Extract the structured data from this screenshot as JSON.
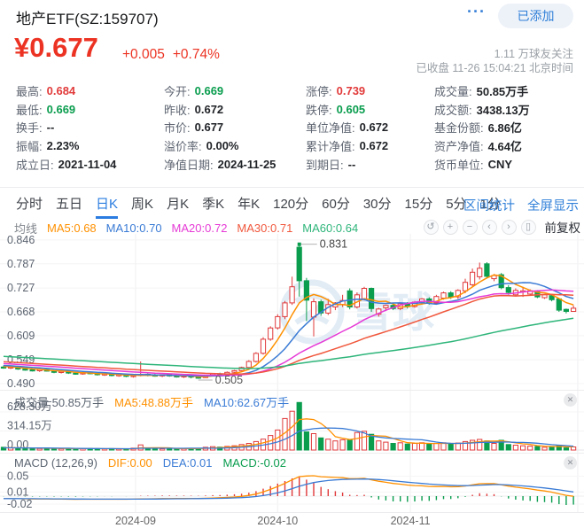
{
  "header": {
    "title": "地产ETF(SZ:159707)",
    "more_icon": "···",
    "added_button": "已添加",
    "price": "¥0.677",
    "change": "+0.005",
    "change_pct": "+0.74%",
    "followers": "1.11 万球友关注",
    "status_line": "已收盘 11-26 15:04:21 北京时间"
  },
  "stats": {
    "columns": [
      [
        {
          "label": "最高",
          "value": "0.684",
          "color": "red"
        },
        {
          "label": "最低",
          "value": "0.669",
          "color": "green"
        },
        {
          "label": "换手",
          "value": "--",
          "color": ""
        },
        {
          "label": "振幅",
          "value": "2.23%",
          "color": ""
        },
        {
          "label": "成立日",
          "value": "2021-11-04",
          "color": ""
        }
      ],
      [
        {
          "label": "今开",
          "value": "0.669",
          "color": "green"
        },
        {
          "label": "昨收",
          "value": "0.672",
          "color": ""
        },
        {
          "label": "市价",
          "value": "0.677",
          "color": ""
        },
        {
          "label": "溢价率",
          "value": "0.00%",
          "color": ""
        },
        {
          "label": "净值日期",
          "value": "2024-11-25",
          "color": ""
        }
      ],
      [
        {
          "label": "涨停",
          "value": "0.739",
          "color": "red"
        },
        {
          "label": "跌停",
          "value": "0.605",
          "color": "green"
        },
        {
          "label": "单位净值",
          "value": "0.672",
          "color": ""
        },
        {
          "label": "累计净值",
          "value": "0.672",
          "color": ""
        },
        {
          "label": "到期日",
          "value": "--",
          "color": ""
        }
      ],
      [
        {
          "label": "成交量",
          "value": "50.85万手",
          "color": ""
        },
        {
          "label": "成交额",
          "value": "3438.13万",
          "color": ""
        },
        {
          "label": "基金份额",
          "value": "6.86亿",
          "color": ""
        },
        {
          "label": "资产净值",
          "value": "4.64亿",
          "color": ""
        },
        {
          "label": "货币单位",
          "value": "CNY",
          "color": ""
        }
      ]
    ]
  },
  "tabs": {
    "items": [
      {
        "label": "分时",
        "active": false
      },
      {
        "label": "五日",
        "active": false
      },
      {
        "label": "日K",
        "active": true
      },
      {
        "label": "周K",
        "active": false
      },
      {
        "label": "月K",
        "active": false
      },
      {
        "label": "季K",
        "active": false
      },
      {
        "label": "年K",
        "active": false
      },
      {
        "label": "120分",
        "active": false
      },
      {
        "label": "60分",
        "active": false
      },
      {
        "label": "30分",
        "active": false
      },
      {
        "label": "15分",
        "active": false
      },
      {
        "label": "5分",
        "active": false
      },
      {
        "label": "1分",
        "active": false
      }
    ],
    "right_links": [
      "区间统计",
      "全屏显示"
    ]
  },
  "ma_legend": {
    "title": "均线",
    "items": [
      {
        "text": "MA5:0.68",
        "color": "#ff9000"
      },
      {
        "text": "MA10:0.70",
        "color": "#3a7bd5"
      },
      {
        "text": "MA20:0.72",
        "color": "#e63ad6"
      },
      {
        "text": "MA30:0.71",
        "color": "#f0573c"
      },
      {
        "text": "MA60:0.64",
        "color": "#2eb57a"
      }
    ]
  },
  "toolbar": {
    "icons": [
      {
        "name": "undo-icon",
        "glyph": "↺"
      },
      {
        "name": "zoom-in-icon",
        "glyph": "+"
      },
      {
        "name": "zoom-out-icon",
        "glyph": "−"
      },
      {
        "name": "pan-left-icon",
        "glyph": "‹"
      },
      {
        "name": "pan-right-icon",
        "glyph": "›"
      },
      {
        "name": "mobile-icon",
        "glyph": "▯"
      }
    ],
    "adjust_label": "前复权"
  },
  "volume_legend": {
    "items": [
      {
        "text": "成交量 50.85万手",
        "color": "#5b6470"
      },
      {
        "text": "MA5:48.88万手",
        "color": "#ff9000"
      },
      {
        "text": "MA10:62.67万手",
        "color": "#3a7bd5"
      }
    ]
  },
  "macd_legend": {
    "items": [
      {
        "text": "MACD (12,26,9)",
        "color": "#5b6470"
      },
      {
        "text": "DIF:0.00",
        "color": "#ff9000"
      },
      {
        "text": "DEA:0.01",
        "color": "#3a7bd5"
      },
      {
        "text": "MACD:-0.02",
        "color": "#0a9d4e"
      }
    ]
  },
  "panel_close_icon": "✕",
  "watermark": "雪球",
  "chart_data": {
    "type": "candlestick",
    "panels": [
      "price",
      "volume",
      "macd"
    ],
    "candles": [
      [
        0.531,
        0.535,
        0.527,
        0.529
      ],
      [
        0.529,
        0.533,
        0.526,
        0.531
      ],
      [
        0.531,
        0.532,
        0.524,
        0.526
      ],
      [
        0.526,
        0.529,
        0.522,
        0.524
      ],
      [
        0.524,
        0.527,
        0.52,
        0.522
      ],
      [
        0.522,
        0.526,
        0.519,
        0.525
      ],
      [
        0.525,
        0.527,
        0.52,
        0.521
      ],
      [
        0.521,
        0.523,
        0.516,
        0.518
      ],
      [
        0.518,
        0.522,
        0.515,
        0.52
      ],
      [
        0.52,
        0.521,
        0.514,
        0.516
      ],
      [
        0.516,
        0.519,
        0.512,
        0.514
      ],
      [
        0.514,
        0.518,
        0.512,
        0.517
      ],
      [
        0.517,
        0.519,
        0.513,
        0.515
      ],
      [
        0.515,
        0.516,
        0.51,
        0.512
      ],
      [
        0.512,
        0.516,
        0.509,
        0.514
      ],
      [
        0.514,
        0.515,
        0.508,
        0.51
      ],
      [
        0.51,
        0.514,
        0.507,
        0.512
      ],
      [
        0.512,
        0.513,
        0.506,
        0.508
      ],
      [
        0.508,
        0.512,
        0.505,
        0.51
      ],
      [
        0.51,
        0.545,
        0.508,
        0.513
      ],
      [
        0.513,
        0.515,
        0.508,
        0.511
      ],
      [
        0.511,
        0.514,
        0.507,
        0.509
      ],
      [
        0.509,
        0.513,
        0.506,
        0.512
      ],
      [
        0.512,
        0.513,
        0.507,
        0.509
      ],
      [
        0.509,
        0.511,
        0.505,
        0.507
      ],
      [
        0.507,
        0.51,
        0.504,
        0.509
      ],
      [
        0.509,
        0.51,
        0.503,
        0.506
      ],
      [
        0.506,
        0.509,
        0.502,
        0.505
      ],
      [
        0.505,
        0.512,
        0.504,
        0.51
      ],
      [
        0.51,
        0.516,
        0.508,
        0.514
      ],
      [
        0.514,
        0.517,
        0.51,
        0.512
      ],
      [
        0.512,
        0.52,
        0.511,
        0.518
      ],
      [
        0.518,
        0.524,
        0.515,
        0.522
      ],
      [
        0.522,
        0.532,
        0.52,
        0.53
      ],
      [
        0.53,
        0.548,
        0.528,
        0.545
      ],
      [
        0.545,
        0.568,
        0.542,
        0.565
      ],
      [
        0.565,
        0.605,
        0.562,
        0.6
      ],
      [
        0.6,
        0.632,
        0.596,
        0.628
      ],
      [
        0.628,
        0.662,
        0.624,
        0.656
      ],
      [
        0.656,
        0.695,
        0.65,
        0.69
      ],
      [
        0.69,
        0.755,
        0.685,
        0.73
      ],
      [
        0.828,
        0.831,
        0.706,
        0.745
      ],
      [
        0.745,
        0.752,
        0.645,
        0.697
      ],
      [
        0.655,
        0.701,
        0.607,
        0.693
      ],
      [
        0.693,
        0.698,
        0.658,
        0.665
      ],
      [
        0.665,
        0.7,
        0.66,
        0.686
      ],
      [
        0.68,
        0.692,
        0.672,
        0.69
      ],
      [
        0.686,
        0.71,
        0.68,
        0.696
      ],
      [
        0.72,
        0.726,
        0.674,
        0.68
      ],
      [
        0.68,
        0.716,
        0.676,
        0.71
      ],
      [
        0.7,
        0.73,
        0.696,
        0.726
      ],
      [
        0.726,
        0.728,
        0.668,
        0.676
      ],
      [
        0.662,
        0.678,
        0.656,
        0.675
      ],
      [
        0.678,
        0.686,
        0.67,
        0.684
      ],
      [
        0.684,
        0.688,
        0.672,
        0.676
      ],
      [
        0.676,
        0.69,
        0.672,
        0.688
      ],
      [
        0.688,
        0.692,
        0.676,
        0.681
      ],
      [
        0.681,
        0.695,
        0.678,
        0.692
      ],
      [
        0.69,
        0.702,
        0.686,
        0.7
      ],
      [
        0.7,
        0.704,
        0.686,
        0.69
      ],
      [
        0.69,
        0.71,
        0.688,
        0.706
      ],
      [
        0.702,
        0.718,
        0.698,
        0.715
      ],
      [
        0.715,
        0.719,
        0.7,
        0.705
      ],
      [
        0.705,
        0.724,
        0.7,
        0.721
      ],
      [
        0.72,
        0.75,
        0.714,
        0.741
      ],
      [
        0.735,
        0.775,
        0.73,
        0.766
      ],
      [
        0.755,
        0.79,
        0.748,
        0.776
      ],
      [
        0.787,
        0.791,
        0.75,
        0.756
      ],
      [
        0.75,
        0.762,
        0.744,
        0.758
      ],
      [
        0.76,
        0.764,
        0.724,
        0.728
      ],
      [
        0.728,
        0.734,
        0.71,
        0.716
      ],
      [
        0.71,
        0.726,
        0.706,
        0.721
      ],
      [
        0.718,
        0.73,
        0.705,
        0.72
      ],
      [
        0.712,
        0.724,
        0.708,
        0.72
      ],
      [
        0.718,
        0.722,
        0.702,
        0.705
      ],
      [
        0.703,
        0.712,
        0.7,
        0.71
      ],
      [
        0.708,
        0.712,
        0.694,
        0.698
      ],
      [
        0.7,
        0.702,
        0.668,
        0.672
      ],
      [
        0.674,
        0.676,
        0.664,
        0.669
      ],
      [
        0.669,
        0.684,
        0.669,
        0.677
      ]
    ],
    "volumes": [
      45,
      38,
      32,
      30,
      28,
      25,
      30,
      24,
      22,
      28,
      22,
      20,
      26,
      21,
      19,
      24,
      18,
      22,
      30,
      85,
      28,
      24,
      22,
      26,
      20,
      24,
      22,
      26,
      45,
      55,
      48,
      60,
      70,
      90,
      110,
      140,
      180,
      240,
      330,
      520,
      640,
      785,
      300,
      270,
      200,
      180,
      150,
      170,
      160,
      290,
      310,
      260,
      150,
      130,
      110,
      120,
      100,
      110,
      120,
      100,
      110,
      120,
      95,
      115,
      140,
      160,
      175,
      150,
      110,
      160,
      90,
      80,
      70,
      65,
      60,
      45,
      55,
      75,
      35,
      51
    ],
    "pre_history": {
      "start": 0.585,
      "step": -0.0009,
      "count": 60,
      "volume": 35
    },
    "price_ticks": [
      0.846,
      0.787,
      0.727,
      0.668,
      0.609,
      0.549,
      0.49
    ],
    "volume_ticks": [
      {
        "label": "628.30万",
        "value": 628.3
      },
      {
        "label": "314.15万",
        "value": 314.15
      },
      {
        "label": "0.00",
        "value": 0
      }
    ],
    "macd_ticks": [
      0.05,
      0.01,
      -0.02
    ],
    "x_axis": [
      {
        "label": "2024-09",
        "index": 18.3
      },
      {
        "label": "2024-10",
        "index": 38.0
      },
      {
        "label": "2024-11",
        "index": 56.4
      }
    ],
    "right_gridline_index": 79.6,
    "annotations": {
      "high": {
        "index": 41,
        "value": 0.831,
        "label": "0.831"
      },
      "low": {
        "index": 27,
        "value": 0.505,
        "label": "0.505"
      }
    },
    "colors": {
      "up": "#e0393b",
      "down": "#0a9d4e",
      "ma5": "#ff9000",
      "ma10": "#3a7bd5",
      "ma20": "#e63ad6",
      "ma30": "#f0573c",
      "ma60": "#2eb57a"
    }
  }
}
